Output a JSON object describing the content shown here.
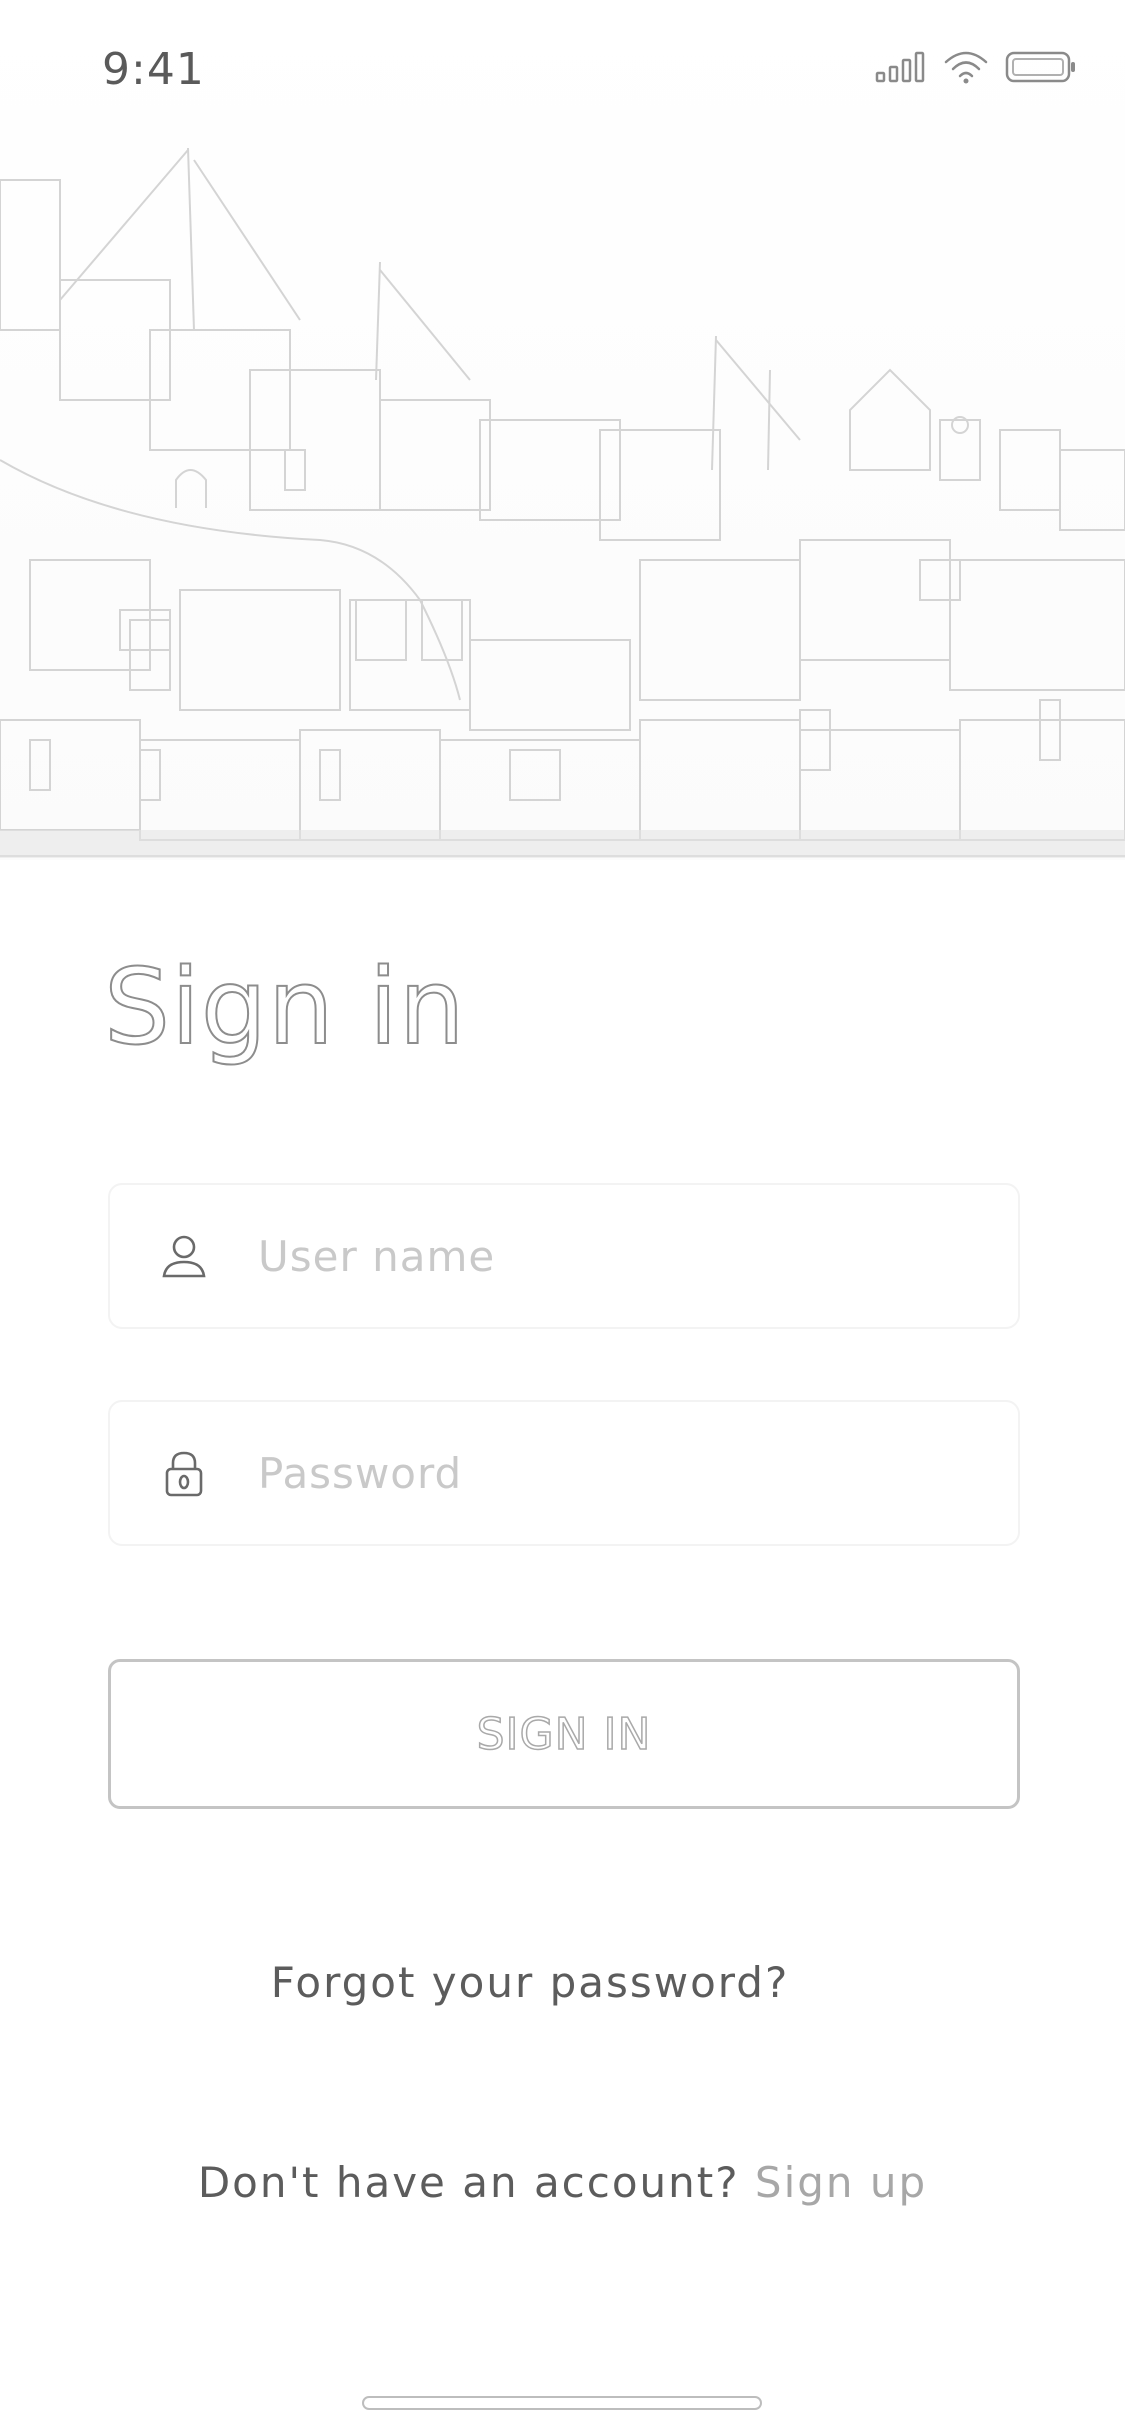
{
  "status_bar": {
    "time": "9:41",
    "icons": [
      "cellular-signal-icon",
      "wifi-icon",
      "battery-icon"
    ]
  },
  "hero": {
    "image": "harbor-town-illustration"
  },
  "page": {
    "title": "Sign in"
  },
  "form": {
    "username": {
      "placeholder": "User name",
      "value": "",
      "icon": "user-icon"
    },
    "password": {
      "placeholder": "Password",
      "value": "",
      "icon": "lock-icon"
    },
    "submit_label": "SIGN IN"
  },
  "links": {
    "forgot": "Forgot your password?",
    "no_account": "Don't have an account?",
    "signup": "Sign up"
  },
  "colors": {
    "text": "#5c5c5c",
    "muted": "#a7a7a7",
    "border": "#c4c4c4",
    "background": "#ffffff"
  }
}
